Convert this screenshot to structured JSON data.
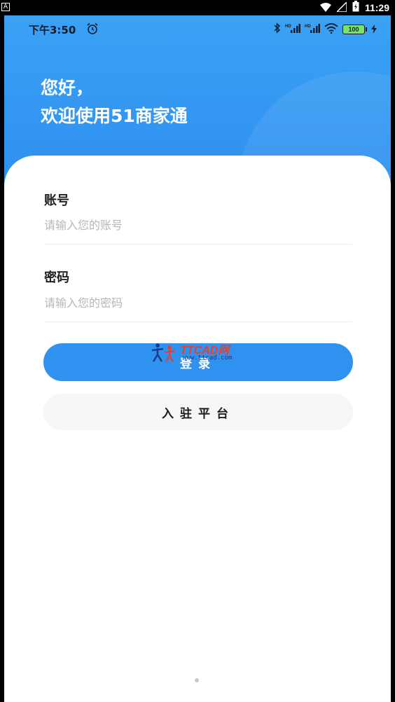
{
  "device_status": {
    "left_glyph": "A",
    "time": "11:29"
  },
  "app_status": {
    "time": "下午3:50",
    "battery": "100"
  },
  "header": {
    "line1": "您好，",
    "line2": "欢迎使用51商家通"
  },
  "form": {
    "account_label": "账号",
    "account_placeholder": "请输入您的账号",
    "password_label": "密码",
    "password_placeholder": "请输入您的密码"
  },
  "buttons": {
    "login": "登录",
    "join": "入驻平台"
  },
  "watermark": {
    "brand": "TTCAD网",
    "url": "www.ttcad.com"
  },
  "colors": {
    "primary": "#2f92f0",
    "hero": "#3aa2f5",
    "secondary_button": "#f5f6f8"
  }
}
